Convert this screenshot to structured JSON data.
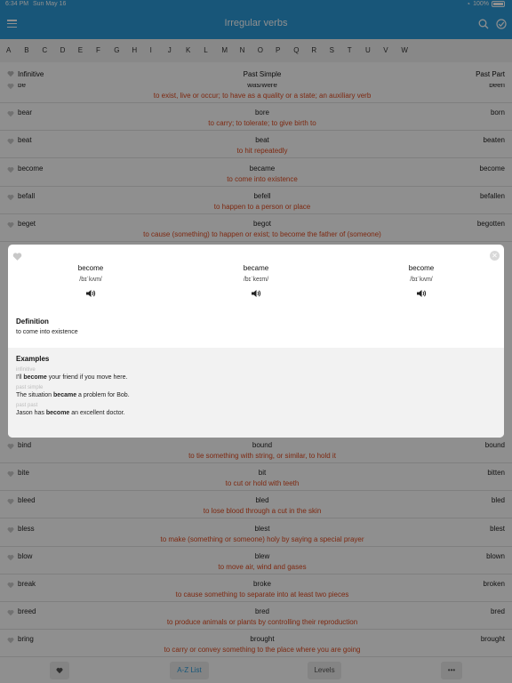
{
  "status": {
    "time": "6:34 PM",
    "date": "Sun May 16",
    "battery": "100%"
  },
  "nav": {
    "title": "Irregular verbs"
  },
  "alphabet": [
    "A",
    "B",
    "C",
    "D",
    "E",
    "F",
    "G",
    "H",
    "I",
    "J",
    "K",
    "L",
    "M",
    "N",
    "O",
    "P",
    "Q",
    "R",
    "S",
    "T",
    "U",
    "V",
    "W"
  ],
  "columns": {
    "infinitive": "Infinitive",
    "past_simple": "Past Simple",
    "past_participle": "Past Part"
  },
  "rows_top": [
    {
      "inf": "be",
      "past": "was/were",
      "pp": "been",
      "def": "to exist, live or occur; to have as a quality or a state; an auxiliary verb"
    },
    {
      "inf": "bear",
      "past": "bore",
      "pp": "born",
      "def": "to carry; to tolerate; to give birth to"
    },
    {
      "inf": "beat",
      "past": "beat",
      "pp": "beaten",
      "def": "to hit repeatedly"
    },
    {
      "inf": "become",
      "past": "became",
      "pp": "become",
      "def": "to come into existence"
    },
    {
      "inf": "befall",
      "past": "befell",
      "pp": "befallen",
      "def": "to happen to a person or place"
    },
    {
      "inf": "beget",
      "past": "begot",
      "pp": "begotten",
      "def": "to cause (something) to happen or exist; to become the father of (someone)"
    }
  ],
  "rows_bottom": [
    {
      "inf": "bind",
      "past": "bound",
      "pp": "bound",
      "def": "to tie something with string, or similar, to hold it"
    },
    {
      "inf": "bite",
      "past": "bit",
      "pp": "bitten",
      "def": "to cut or hold with teeth"
    },
    {
      "inf": "bleed",
      "past": "bled",
      "pp": "bled",
      "def": "to lose blood through a cut in the skin"
    },
    {
      "inf": "bless",
      "past": "blest",
      "pp": "blest",
      "def": "to make (something or someone) holy by saying a special prayer"
    },
    {
      "inf": "blow",
      "past": "blew",
      "pp": "blown",
      "def": "to move air, wind and gases"
    },
    {
      "inf": "break",
      "past": "broke",
      "pp": "broken",
      "def": "to cause something to separate into at least two pieces"
    },
    {
      "inf": "breed",
      "past": "bred",
      "pp": "bred",
      "def": "to produce animals or plants by controlling their reproduction"
    },
    {
      "inf": "bring",
      "past": "brought",
      "pp": "brought",
      "def": "to carry or convey something to the place where you are going"
    }
  ],
  "toolbar": {
    "az_label": "A-Z List",
    "levels_label": "Levels",
    "more_label": "•••"
  },
  "dialog": {
    "forms": [
      {
        "word": "become",
        "ipa": "/bɪˈkʌm/"
      },
      {
        "word": "became",
        "ipa": "/bɪˈkeɪm/"
      },
      {
        "word": "become",
        "ipa": "/bɪˈkʌm/"
      }
    ],
    "definition_title": "Definition",
    "definition": "to come into existence",
    "examples_title": "Examples",
    "examples": [
      {
        "label": "infinitive",
        "before": "I'll ",
        "bold": "become",
        "after": " your friend if you move here."
      },
      {
        "label": "past simple",
        "before": "The situation ",
        "bold": "became",
        "after": " a problem for Bob."
      },
      {
        "label": "past past",
        "before": "Jason has ",
        "bold": "become",
        "after": " an excellent doctor."
      }
    ]
  },
  "colors": {
    "accent": "#2b9ad8",
    "definition": "#e04a1f"
  }
}
